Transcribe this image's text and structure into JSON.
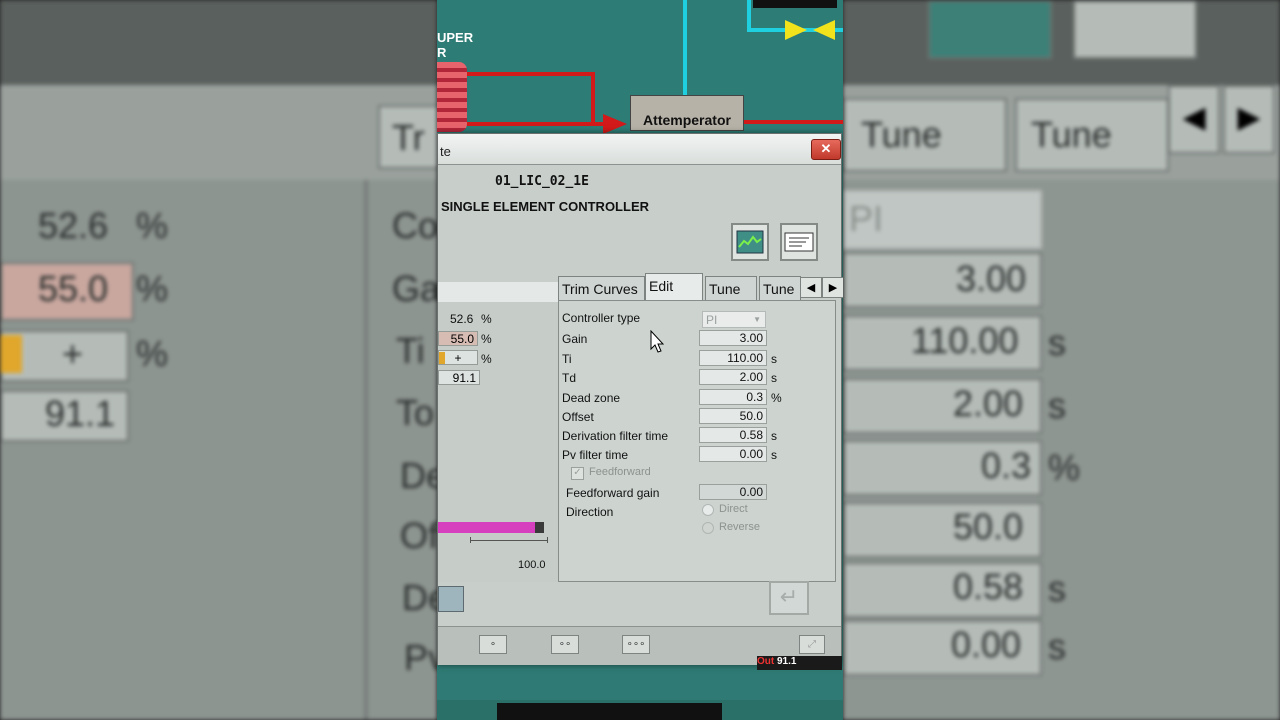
{
  "background_left": {
    "values": [
      "52.6",
      "55.0",
      "+",
      "91.1"
    ],
    "unit": "%",
    "partial_labels": [
      "Co",
      "Ga",
      "Ti",
      "To",
      "De",
      "Of",
      "De",
      "Pv"
    ],
    "tab_fragment": "Tr"
  },
  "background_right": {
    "tabs": [
      "Tune",
      "Tune"
    ],
    "select_value": "PI",
    "values": [
      "3.00",
      "110.00",
      "2.00",
      "0.3",
      "50.0",
      "0.58",
      "0.00"
    ],
    "units": [
      "",
      "s",
      "s",
      "%",
      "",
      "s",
      "s"
    ]
  },
  "scada": {
    "label_fragment_1": "UPER",
    "label_fragment_2": "R",
    "attemperator_label": "Attemperator",
    "out_label": "Out",
    "out_value": "91.1"
  },
  "dialog": {
    "title": "te",
    "close_label": "✕",
    "tag": "01_LIC_02_1E",
    "description": "SINGLE ELEMENT CONTROLLER",
    "toolbar": {
      "trend_icon": "trend-icon",
      "faceplate_icon": "faceplate-icon"
    },
    "left_panel": {
      "pv_value": "52.6",
      "pv_unit": "%",
      "sp_value": "55.0",
      "sp_unit": "%",
      "out_value": "+",
      "out_unit": "%",
      "tot_value": "91.1",
      "bar_max_label": "100.0",
      "bar_fill_pct": 91.1
    },
    "tabs": [
      "Trim Curves",
      "Edit",
      "Tune",
      "Tune"
    ],
    "active_tab": "Edit",
    "tune": {
      "controller_type_label": "Controller type",
      "controller_type_value": "PI",
      "rows": [
        {
          "label": "Gain",
          "value": "3.00",
          "unit": ""
        },
        {
          "label": "Ti",
          "value": "110.00",
          "unit": "s"
        },
        {
          "label": "Td",
          "value": "2.00",
          "unit": "s"
        },
        {
          "label": "Dead zone",
          "value": "0.3",
          "unit": "%"
        },
        {
          "label": "Offset",
          "value": "50.0",
          "unit": ""
        },
        {
          "label": "Derivation filter time",
          "value": "0.58",
          "unit": "s"
        },
        {
          "label": "Pv filter time",
          "value": "0.00",
          "unit": "s"
        }
      ],
      "feedforward_label": "Feedforward",
      "feedforward_gain_label": "Feedforward gain",
      "feedforward_gain_value": "0.00",
      "direction_label": "Direction",
      "direct_label": "Direct",
      "reverse_label": "Reverse"
    },
    "footer": {
      "btn1": "∘",
      "btn2": "∘∘",
      "btn3": "∘∘∘"
    }
  },
  "colors": {
    "pipe_red": "#d21a1a",
    "pipe_cyan": "#1ed0e0",
    "bar_fill": "#d63fbe",
    "scada_bg": "#2d7c76"
  }
}
